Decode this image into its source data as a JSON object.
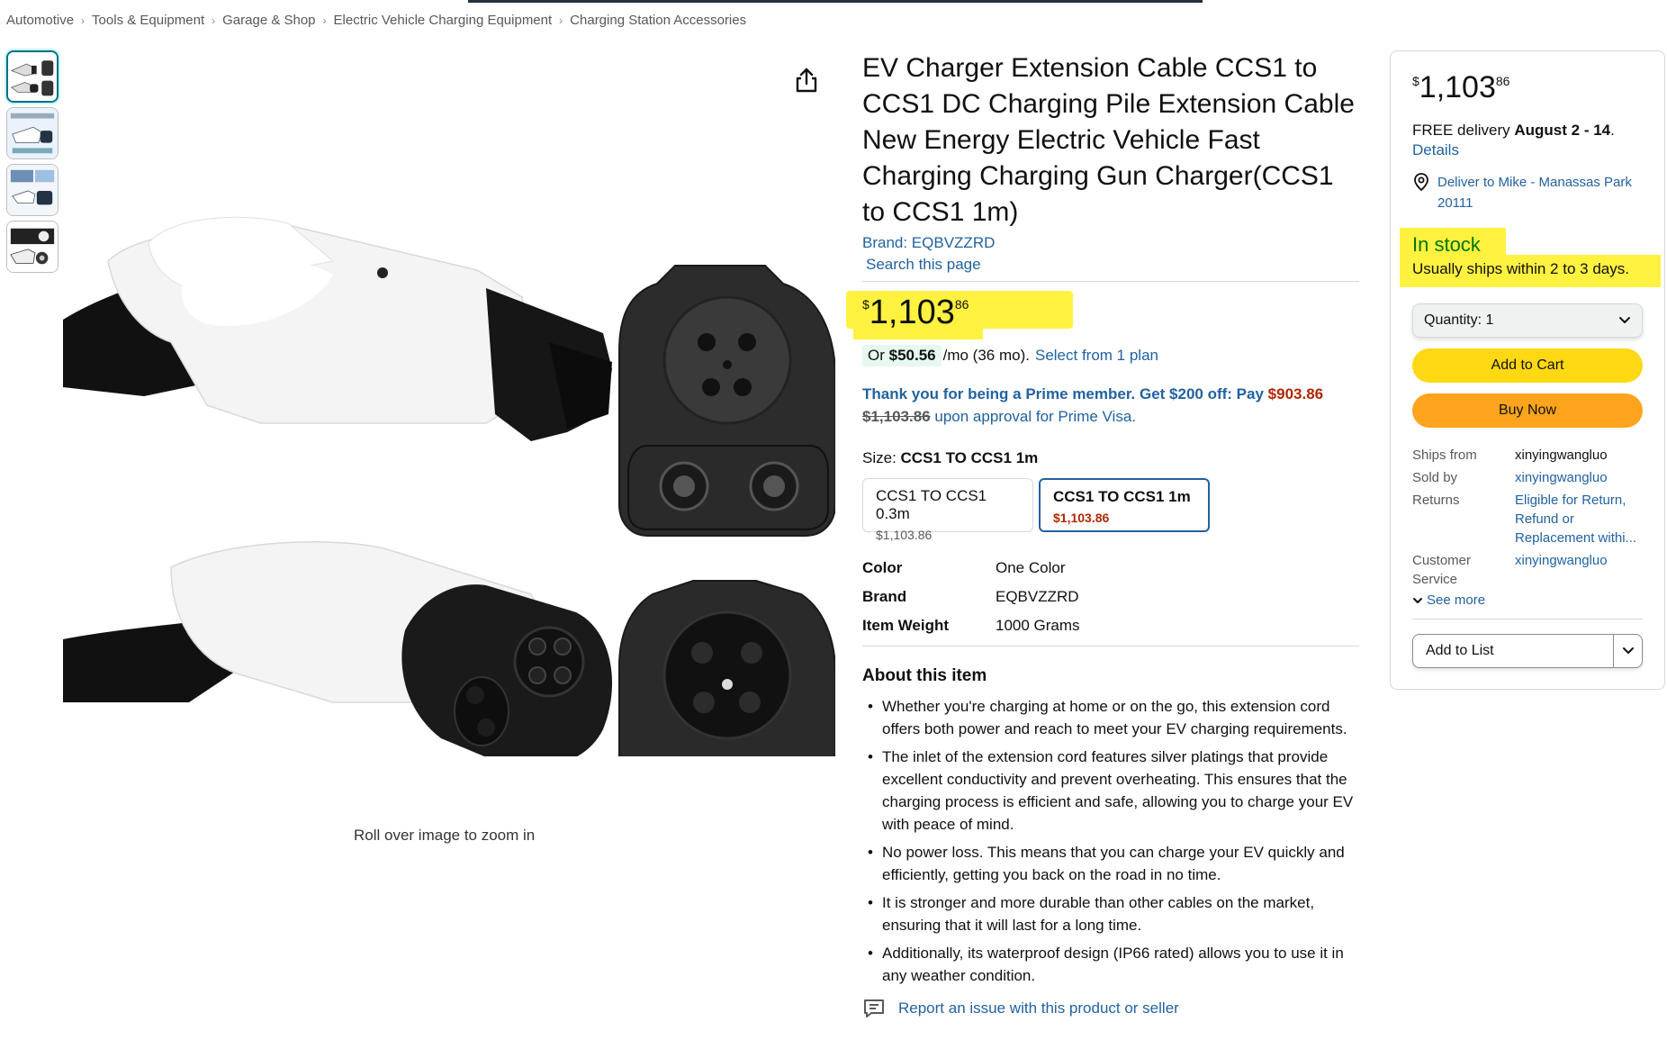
{
  "breadcrumb": [
    "Automotive",
    "Tools & Equipment",
    "Garage & Shop",
    "Electric Vehicle Charging Equipment",
    "Charging Station Accessories"
  ],
  "breadcrumb_separator": "›",
  "gallery": {
    "zoom_hint": "Roll over image to zoom in"
  },
  "product": {
    "title": "EV Charger Extension Cable CCS1 to CCS1 DC Charging Pile Extension Cable New Energy Electric Vehicle Fast Charging Charging Gun Charger(CCS1 to CCS1 1m)",
    "brand_link": "Brand: EQBVZZRD",
    "search_page": "Search this page",
    "price": {
      "symbol": "$",
      "whole": "1,103",
      "fraction": "86"
    },
    "monthly": {
      "or": "Or",
      "amount": "$50.56",
      "rest": "/mo (36 mo).",
      "plan_link": "Select from 1 plan"
    },
    "prime": {
      "text": "Thank you for being a Prime member. Get $200 off: Pay",
      "new_price": "$903.86",
      "old_price": "$1,103.86",
      "suffix": "upon approval for Prime Visa."
    },
    "size_label": "Size:",
    "size_selected": "CCS1 TO CCS1 1m",
    "size_options": [
      {
        "name": "CCS1 TO CCS1 0.3m",
        "price": "$1,103.86",
        "selected": false
      },
      {
        "name": "CCS1 TO CCS1 1m",
        "price": "$1,103.86",
        "selected": true
      }
    ],
    "specs": [
      {
        "key": "Color",
        "value": "One Color"
      },
      {
        "key": "Brand",
        "value": "EQBVZZRD"
      },
      {
        "key": "Item Weight",
        "value": "1000 Grams"
      }
    ],
    "about_title": "About this item",
    "bullets": [
      "Whether you're charging at home or on the go, this extension cord offers both power and reach to meet your EV charging requirements.",
      "The inlet of the extension cord features silver platings that provide excellent conductivity and prevent overheating. This ensures that the charging process is efficient and safe, allowing you to charge your EV with peace of mind.",
      "No power loss. This means that you can charge your EV quickly and efficiently, getting you back on the road in no time.",
      "It is stronger and more durable than other cables on the market, ensuring that it will last for a long time.",
      "Additionally, its waterproof design (IP66 rated) allows you to use it in any weather condition."
    ],
    "report_link": "Report an issue with this product or seller"
  },
  "buybox": {
    "price": {
      "symbol": "$",
      "whole": "1,103",
      "fraction": "86"
    },
    "delivery_prefix": "FREE delivery",
    "delivery_date": "August 2 - 14",
    "delivery_suffix": ".",
    "details_link": "Details",
    "deliver_to": "Deliver to Mike - Manassas Park 20111",
    "in_stock": "In stock",
    "ships_note": "Usually ships within 2 to 3 days.",
    "quantity_label": "Quantity:",
    "quantity_value": "1",
    "add_to_cart": "Add to Cart",
    "buy_now": "Buy Now",
    "seller_rows": [
      {
        "key": "Ships from",
        "value": "xinyingwangluo",
        "link": false
      },
      {
        "key": "Sold by",
        "value": "xinyingwangluo",
        "link": true
      },
      {
        "key": "Returns",
        "value": "Eligible for Return, Refund or Replacement withi...",
        "link": true
      },
      {
        "key": "Customer Service",
        "value": "xinyingwangluo",
        "link": true
      }
    ],
    "see_more": "See more",
    "add_to_list": "Add to List"
  },
  "colors": {
    "link": "#2162a1",
    "highlight": "#fff140",
    "in_stock": "#007600",
    "add_to_cart": "#ffd814",
    "buy_now": "#ffa41c",
    "deal_price": "#b12704"
  },
  "icons": [
    "share-icon",
    "location-pin-icon",
    "chevron-down-icon",
    "report-icon"
  ]
}
